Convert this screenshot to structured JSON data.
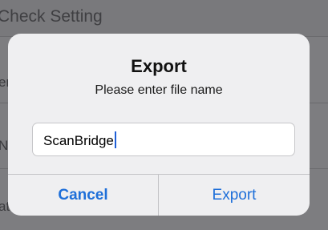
{
  "background": {
    "title": "Check Setting",
    "fragments": [
      "er",
      "N",
      "at"
    ]
  },
  "alert": {
    "title": "Export",
    "message": "Please enter file name",
    "input": {
      "value": "ScanBridge"
    },
    "buttons": {
      "cancel": "Cancel",
      "export": "Export"
    }
  },
  "colors": {
    "accent": "#1e6fd9",
    "dim_overlay": "#7d7d80"
  }
}
